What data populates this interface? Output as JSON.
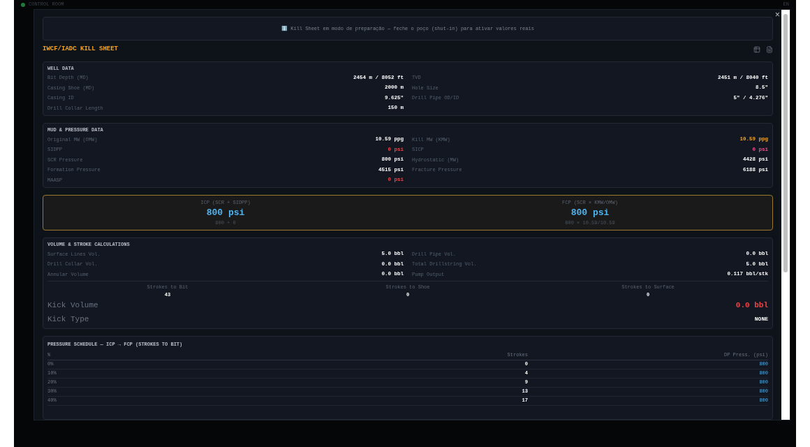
{
  "app_bar": {
    "title": "CONTROL ROOM",
    "language": "EN"
  },
  "modal": {
    "banner": {
      "icon": "ℹ️",
      "text": "Kill Sheet em modo de preparação — feche o poço (shut-in) para ativar valores reais"
    },
    "title": "IWCF/IADC KILL SHEET",
    "close": "×",
    "sections": [
      {
        "kind": "pairs",
        "title": "WELL DATA",
        "rows": [
          [
            {
              "label": "Bit Depth (MD)",
              "value": "2454 m / 8052 ft",
              "color": "#ffffff"
            },
            {
              "label": "TVD",
              "value": "2451 m / 8040 ft",
              "color": "#ffffff"
            }
          ],
          [
            {
              "label": "Casing Shoe (MD)",
              "value": "2000 m",
              "color": "#ffffff"
            },
            {
              "label": "Hole Size",
              "value": "8.5\"",
              "color": "#ffffff"
            }
          ],
          [
            {
              "label": "Casing ID",
              "value": "9.625\"",
              "color": "#ffffff"
            },
            {
              "label": "Drill Pipe OD/ID",
              "value": "5\" / 4.276\"",
              "color": "#ffffff"
            }
          ],
          [
            {
              "label": "Drill Collar Length",
              "value": "150 m",
              "color": "#ffffff"
            }
          ]
        ]
      },
      {
        "kind": "pairs",
        "title": "MUD & PRESSURE DATA",
        "rows": [
          [
            {
              "label": "Original MW (OMW)",
              "value": "10.59 ppg",
              "color": "#ffffff"
            },
            {
              "label": "Kill MW (KMW)",
              "value": "10.59 ppg",
              "color": "#f5a623"
            }
          ],
          [
            {
              "label": "SIDPP",
              "value": "0 psi",
              "color": "#ef4444"
            },
            {
              "label": "SICP",
              "value": "0 psi",
              "color": "#f0508c"
            }
          ],
          [
            {
              "label": "SCR Pressure",
              "value": "800 psi",
              "color": "#ffffff"
            },
            {
              "label": "Hydrostatic (MW)",
              "value": "4428 psi",
              "color": "#ffffff"
            }
          ],
          [
            {
              "label": "Formation Pressure",
              "value": "4515 psi",
              "color": "#ffffff"
            },
            {
              "label": "Fracture Pressure",
              "value": "6188 psi",
              "color": "#ffffff"
            }
          ],
          [
            {
              "label": "MAASP",
              "value": "0 psi",
              "color": "#ef4444"
            }
          ]
        ]
      },
      {
        "kind": "highlight",
        "items": [
          {
            "label": "ICP (SCR + SIDPP)",
            "value": "800 psi",
            "formula": "800 + 0"
          },
          {
            "label": "FCP (SCR × KMW/OMW)",
            "value": "800 psi",
            "formula": "800 × 10.59/10.59"
          }
        ]
      },
      {
        "kind": "volume",
        "title": "VOLUME & STROKE CALCULATIONS",
        "rows": [
          [
            {
              "label": "Surface Lines Vol.",
              "value": "5.0 bbl",
              "color": "#ffffff"
            },
            {
              "label": "Drill Pipe Vol.",
              "value": "0.0 bbl",
              "color": "#ffffff"
            }
          ],
          [
            {
              "label": "Drill Collar Vol.",
              "value": "0.0 bbl",
              "color": "#ffffff"
            },
            {
              "label": "Total Drillstring Vol.",
              "value": "5.0 bbl",
              "color": "#ffffff"
            }
          ],
          [
            {
              "label": "Annular Volume",
              "value": "0.0 bbl",
              "color": "#ffffff"
            },
            {
              "label": "Pump Output",
              "value": "0.117 bbl/stk",
              "color": "#ffffff"
            }
          ]
        ],
        "strokes": [
          {
            "label": "Strokes to Bit",
            "value": "43"
          },
          {
            "label": "Strokes to Shoe",
            "value": "0"
          },
          {
            "label": "Strokes to Surface",
            "value": "0"
          }
        ],
        "big": [
          {
            "label": "Kick Volume",
            "value": "0.0 bbl",
            "color": "#ef4444"
          },
          {
            "label": "Kick Type",
            "value": "NONE",
            "color": "#ffffff"
          }
        ]
      },
      {
        "kind": "table",
        "title": "PRESSURE SCHEDULE — ICP → FCP (STROKES TO BIT)",
        "columns": [
          "%",
          "Strokes",
          "DP Press. (psi)"
        ],
        "rows": [
          [
            "0%",
            "0",
            "800"
          ],
          [
            "10%",
            "4",
            "800"
          ],
          [
            "20%",
            "9",
            "800"
          ],
          [
            "30%",
            "13",
            "800"
          ],
          [
            "40%",
            "17",
            "800"
          ]
        ]
      }
    ]
  }
}
